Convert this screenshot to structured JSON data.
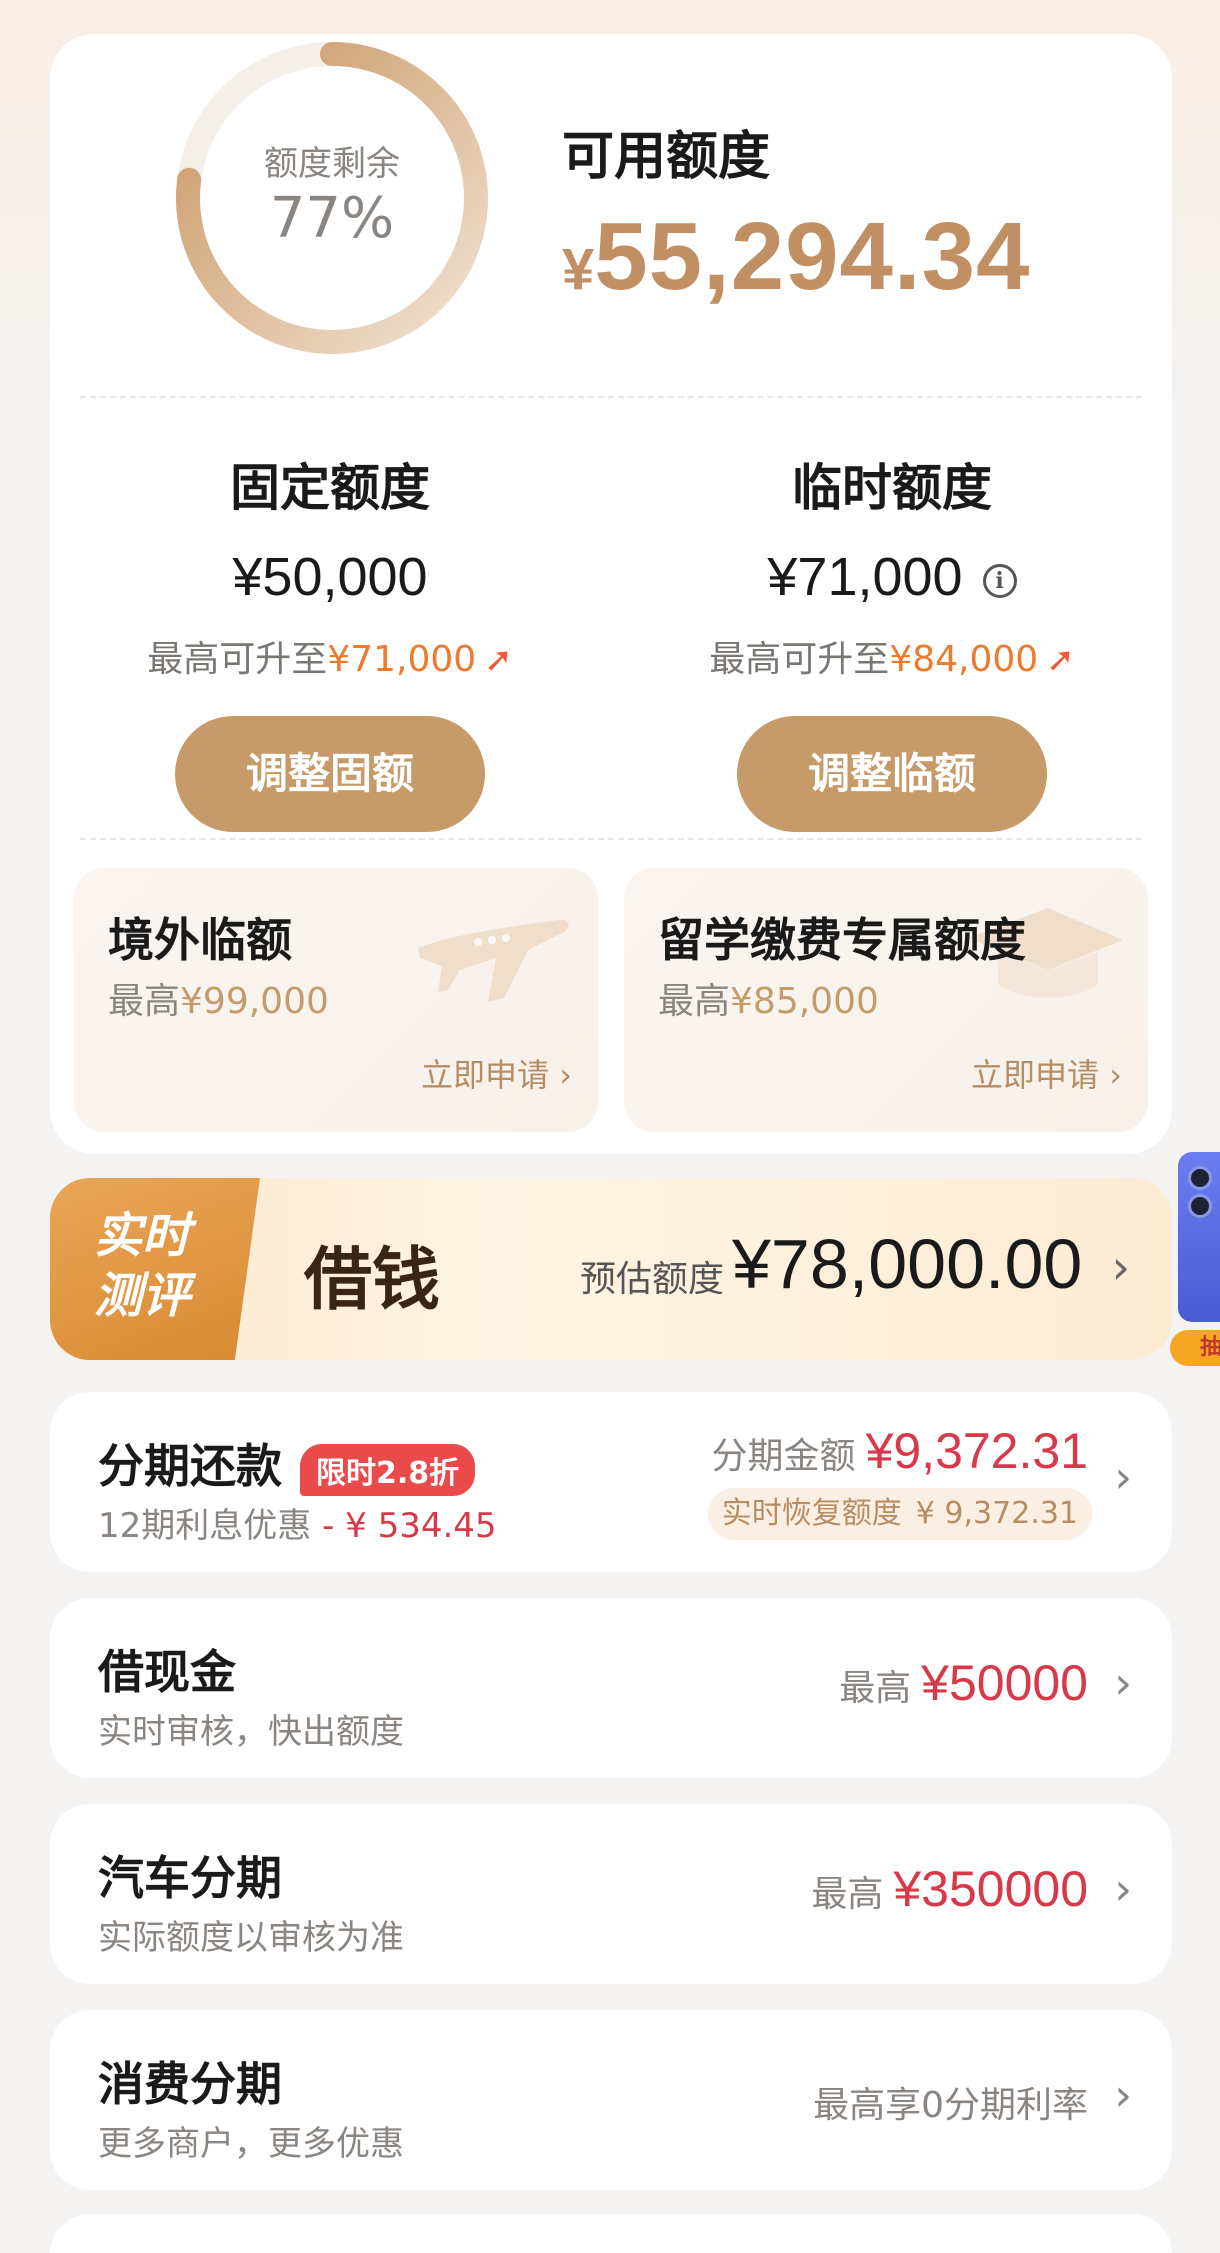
{
  "credit": {
    "ring_label": "额度剩余",
    "ring_percent_text": "77%",
    "ring_fraction": 0.77,
    "available_title": "可用额度",
    "available_currency": "¥",
    "available_amount": "55,294.34",
    "fixed": {
      "title": "固定额度",
      "value": "¥50,000",
      "up_prefix": "最高可升至",
      "up_amount": "¥71,000",
      "button": "调整固额"
    },
    "temporary": {
      "title": "临时额度",
      "value": "¥71,000",
      "up_prefix": "最高可升至",
      "up_amount": "¥84,000",
      "button": "调整临额"
    },
    "overseas": {
      "title": "境外临额",
      "max_prefix": "最高",
      "max_amount": "¥99,000",
      "link": "立即申请 ›"
    },
    "study_abroad": {
      "title": "留学缴费专属额度",
      "max_prefix": "最高",
      "max_amount": "¥85,000",
      "link": "立即申请 ›"
    }
  },
  "borrow_banner": {
    "tag_line1": "实时",
    "tag_line2": "测评",
    "title": "借钱",
    "estimate_label": "预估额度",
    "estimate_amount": "¥78,000.00",
    "side_tag": "抽"
  },
  "installment": {
    "title": "分期还款",
    "badge": "限时2.8折",
    "subtitle_prefix": "12期利息优惠",
    "subtitle_discount": "- ¥ 534.45",
    "amount_label": "分期金额",
    "amount": "¥9,372.31",
    "restore_label": "实时恢复额度",
    "restore_amount": "¥ 9,372.31"
  },
  "cash_loan": {
    "title": "借现金",
    "subtitle": "实时审核，快出额度",
    "max_label": "最高",
    "max_amount": "¥50000"
  },
  "auto_loan": {
    "title": "汽车分期",
    "subtitle": "实际额度以审核为准",
    "max_label": "最高",
    "max_amount": "¥350000"
  },
  "consumer_installment": {
    "title": "消费分期",
    "subtitle": "更多商户，更多优惠",
    "right_text": "最高享0分期利率"
  },
  "colors": {
    "accent_gold": "#c79a69",
    "amount_gold": "#c09064",
    "orange": "#ef7a2e",
    "red": "#d8394a"
  }
}
